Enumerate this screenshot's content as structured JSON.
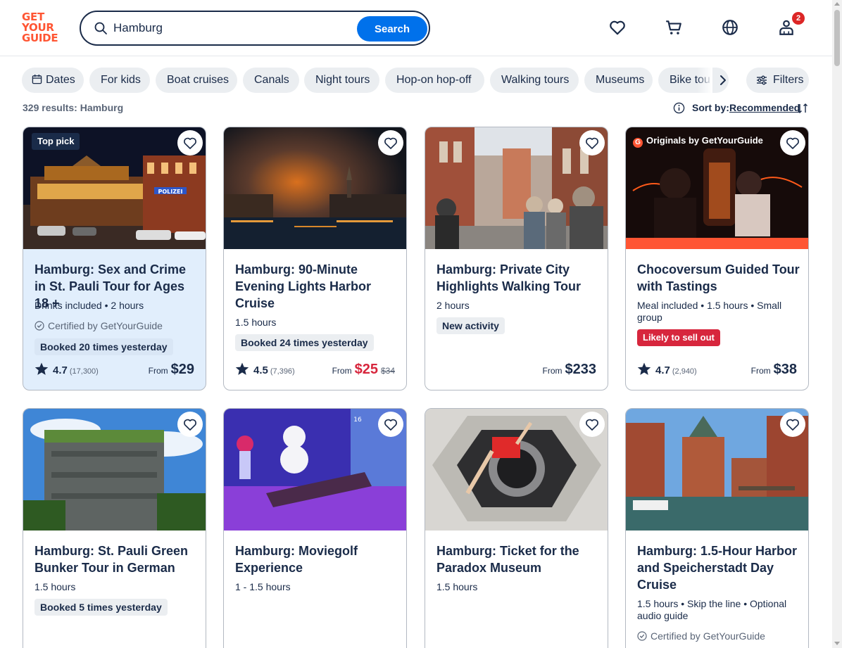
{
  "header": {
    "logo_lines": [
      "GET",
      "YOUR",
      "GUIDE"
    ],
    "search_value": "Hamburg",
    "search_button": "Search",
    "cart_badge": "2"
  },
  "chips": [
    "Dates",
    "For kids",
    "Boat cruises",
    "Canals",
    "Night tours",
    "Hop-on hop-off",
    "Walking tours",
    "Museums",
    "Bike tou"
  ],
  "filters_label": "Filters",
  "results_text": "329 results: Hamburg",
  "sort": {
    "label": "Sort by:",
    "value": "Recommended"
  },
  "cards": [
    {
      "badge": "Top pick",
      "title": "Hamburg: Sex and Crime in St. Pauli Tour for Ages 18 +",
      "meta": "Drinks included • 2 hours",
      "certified": "Certified by GetYourGuide",
      "booked": "Booked 20 times yesterday",
      "rating": "4.7",
      "reviews": "(17,300)",
      "from": "From",
      "price": "$29"
    },
    {
      "title": "Hamburg: 90-Minute Evening Lights Harbor Cruise",
      "meta": "1.5 hours",
      "booked": "Booked 24 times yesterday",
      "rating": "4.5",
      "reviews": "(7,396)",
      "from": "From",
      "price": "$25",
      "old_price": "$34"
    },
    {
      "title": "Hamburg: Private City Highlights Walking Tour",
      "meta": "2 hours",
      "tag": "New activity",
      "from": "From",
      "price": "$233"
    },
    {
      "badge": "Originals by GetYourGuide",
      "badge_icon": "G",
      "title": "Chocoversum Guided Tour with Tastings",
      "meta": "Meal included • 1.5 hours • Small group",
      "alert": "Likely to sell out",
      "rating": "4.7",
      "reviews": "(2,940)",
      "from": "From",
      "price": "$38"
    },
    {
      "title": "Hamburg: St. Pauli Green Bunker Tour in German",
      "meta": "1.5 hours",
      "booked": "Booked 5 times yesterday"
    },
    {
      "title": "Hamburg: Moviegolf Experience",
      "meta": "1 - 1.5 hours",
      "image_label": "16"
    },
    {
      "title": "Hamburg: Ticket for the Paradox Museum",
      "meta": "1.5 hours"
    },
    {
      "title": "Hamburg: 1.5-Hour Harbor and Speicherstadt Day Cruise",
      "meta": "1.5 hours • Skip the line • Optional audio guide",
      "certified": "Certified by GetYourGuide"
    }
  ],
  "image_signs": {
    "polizei": "POLIZEI"
  },
  "colors": {
    "brand": "#ff5533",
    "primary": "#0071eb",
    "text": "#1a2b49",
    "sale": "#d7263d",
    "chip_bg": "#ebeef1",
    "highlight_bg": "#e1eefc"
  },
  "icons": [
    "search-icon",
    "heart-icon",
    "cart-icon",
    "globe-icon",
    "profile-icon",
    "calendar-icon",
    "chevron-right-icon",
    "filters-icon",
    "info-icon",
    "sort-icon",
    "star-icon",
    "check-badge-icon"
  ]
}
